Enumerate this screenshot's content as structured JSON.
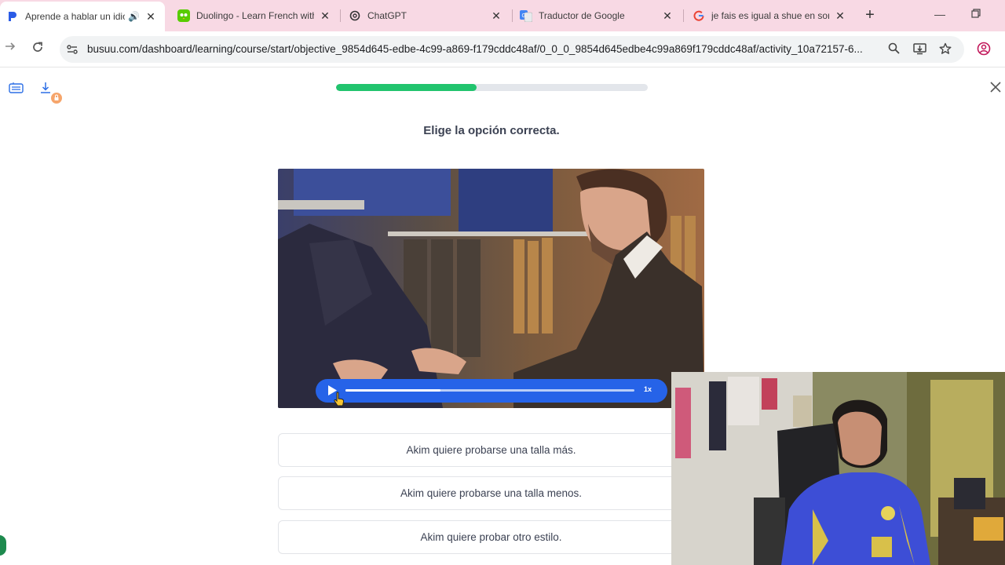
{
  "browser": {
    "tabs": [
      {
        "title": "Aprende a hablar un idioma",
        "active": true,
        "audio": true,
        "favicon": "busuu-icon"
      },
      {
        "title": "Duolingo - Learn French with",
        "active": false,
        "favicon": "duolingo-icon"
      },
      {
        "title": "ChatGPT",
        "active": false,
        "favicon": "chatgpt-icon"
      },
      {
        "title": "Traductor de Google",
        "active": false,
        "favicon": "google-translate-icon"
      },
      {
        "title": "je fais es igual a shue en son",
        "active": false,
        "favicon": "google-icon"
      }
    ],
    "new_tab_label": "+",
    "url": "busuu.com/dashboard/learning/course/start/objective_9854d645-edbe-4c99-a869-f179cddc48af/0_0_0_9854d645edbe4c99a869f179cddc48af/activity_10a72157-6..."
  },
  "lesson": {
    "progress_fraction": 0.45,
    "instruction": "Elige la opción correcta.",
    "audio": {
      "played_fraction": 0.33,
      "speed": "1x"
    },
    "options": [
      "Akim quiere probarse una talla más.",
      "Akim quiere probarse una talla menos.",
      "Akim quiere probar otro estilo."
    ]
  },
  "colors": {
    "tabbar": "#f8d9e4",
    "progress": "#21c46e",
    "audio_bar": "#2663e8"
  }
}
